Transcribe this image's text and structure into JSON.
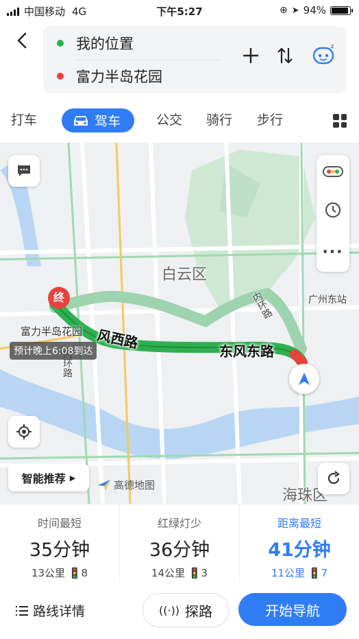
{
  "status_bar": {
    "carrier": "中国移动",
    "network": "4G",
    "time": "下午5:27",
    "battery_text": "94%",
    "battery_level": 0.94
  },
  "header": {
    "origin": "我的位置",
    "destination": "富力半岛花园",
    "icons": [
      "back-icon",
      "add-waypoint-icon",
      "swap-icon",
      "assistant-robot-icon"
    ]
  },
  "modes": [
    {
      "label": "打车"
    },
    {
      "label": "驾车",
      "active": true
    },
    {
      "label": "公交"
    },
    {
      "label": "骑行"
    },
    {
      "label": "步行"
    }
  ],
  "map": {
    "district_label": "白云区",
    "district2_label": "海珠区",
    "station_label": "广州东站",
    "road1": "风西路",
    "road2": "东风东路",
    "road3": "内环路",
    "road4": "内环路",
    "dest_name": "富力半岛花园",
    "dest_marker": "终",
    "eta": "预计晚上6:08到达",
    "smart_btn": "智能推荐",
    "logo_text": "高德地图",
    "colors": {
      "route": "#2fb04f",
      "route_alt": "#9dd3ae",
      "accent": "#2f7cf5",
      "dest": "#e8423d"
    }
  },
  "plans": [
    {
      "label": "时间最短",
      "time": "35分钟",
      "distance": "13公里",
      "lights": "8"
    },
    {
      "label": "红绿灯少",
      "time": "36分钟",
      "distance": "14公里",
      "lights": "3"
    },
    {
      "label": "距离最短",
      "time": "41分钟",
      "distance": "11公里",
      "lights": "7",
      "selected": true
    }
  ],
  "bottom": {
    "detail": "路线详情",
    "explore": "探路",
    "start": "开始导航"
  }
}
